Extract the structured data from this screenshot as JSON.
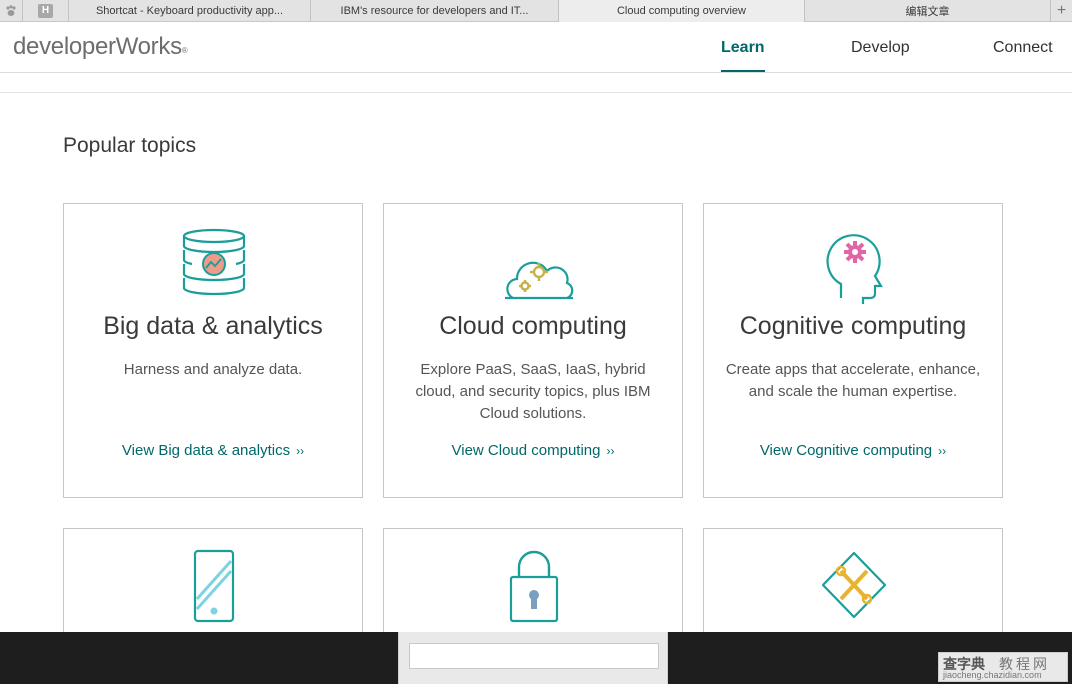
{
  "browser": {
    "tabs": [
      {
        "label": "Shortcat - Keyboard productivity app..."
      },
      {
        "label": "IBM's resource for developers and IT..."
      },
      {
        "label": "Cloud computing overview"
      },
      {
        "label": "编辑文章"
      }
    ],
    "pinned_tab_letter": "H",
    "new_tab_glyph": "+"
  },
  "header": {
    "logo": "developerWorks",
    "logo_mark": "®",
    "nav": [
      {
        "label": "Learn",
        "active": true
      },
      {
        "label": "Develop",
        "active": false
      },
      {
        "label": "Connect",
        "active": false
      }
    ]
  },
  "section": {
    "title": "Popular topics"
  },
  "cards": [
    {
      "icon": "database-analytics-icon",
      "title": "Big data & analytics",
      "description": "Harness and analyze data.",
      "link": "View Big data & analytics",
      "chevron": "››"
    },
    {
      "icon": "cloud-gears-icon",
      "title": "Cloud computing",
      "description": "Explore PaaS, SaaS, IaaS, hybrid cloud, and security topics, plus IBM Cloud solutions.",
      "link": "View Cloud computing",
      "chevron": "››"
    },
    {
      "icon": "head-gear-icon",
      "title": "Cognitive computing",
      "description": "Create apps that accelerate, enhance, and scale the human expertise.",
      "link": "View Cognitive computing",
      "chevron": "››"
    },
    {
      "icon": "mobile-phone-icon"
    },
    {
      "icon": "padlock-icon"
    },
    {
      "icon": "wrench-screwdriver-icon"
    }
  ],
  "overlay": {
    "search_value": ""
  },
  "watermark": {
    "line1": "查字典",
    "line2": "教程网",
    "line3": "jiaocheng.chazidian.com"
  },
  "colors": {
    "accent": "#00686b",
    "icon_teal": "#1a9e9a",
    "icon_pink": "#e066a6",
    "icon_gold": "#c7b24a"
  }
}
